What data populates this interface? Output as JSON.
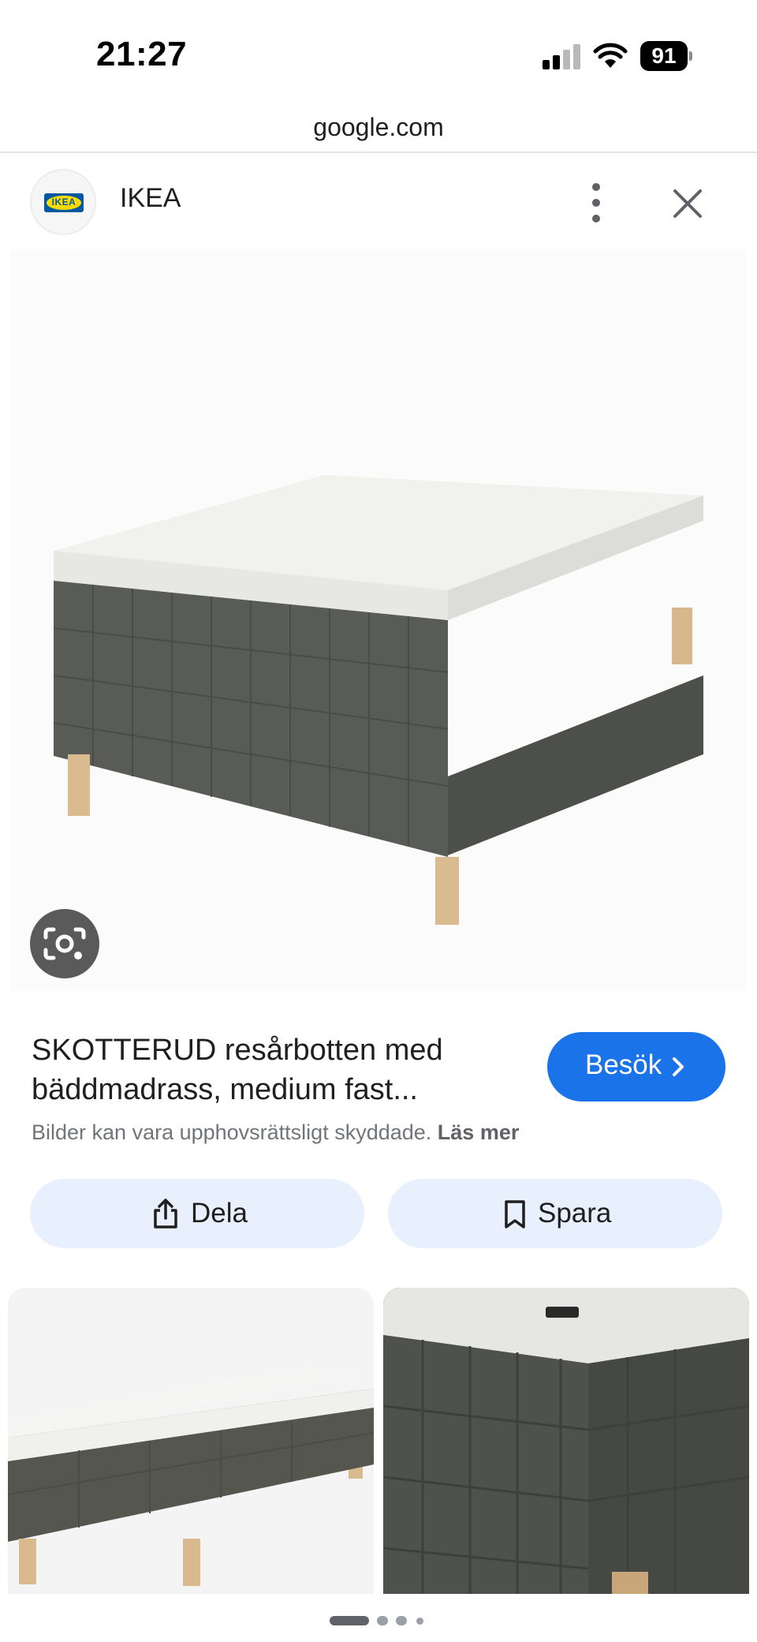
{
  "status_bar": {
    "time": "21:27",
    "battery": "91"
  },
  "browser": {
    "url": "google.com"
  },
  "source": {
    "name": "IKEA",
    "logo_text": "IKEA"
  },
  "product": {
    "title": "SKOTTERUD resårbotten med bäddmadrass, medium fast...",
    "visit_label": "Besök",
    "copyright_text": "Bilder kan vara upphovsrättsligt skyddade.",
    "copyright_link": "Läs mer"
  },
  "actions": {
    "share_label": "Dela",
    "save_label": "Spara"
  },
  "colors": {
    "accent": "#1a73e8",
    "pill_bg": "#e8f0fd",
    "lens_bg": "#5a5a5a"
  },
  "pager": {
    "pages": 4,
    "active": 0
  }
}
